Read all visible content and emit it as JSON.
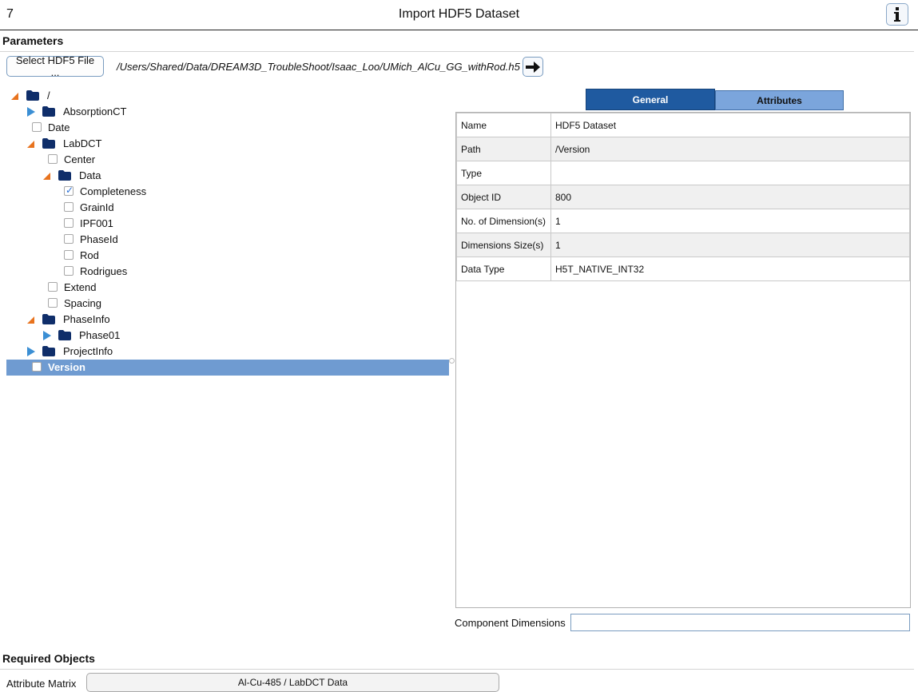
{
  "header": {
    "number": "7",
    "title": "Import HDF5 Dataset"
  },
  "parameters": {
    "section_title": "Parameters",
    "select_file_label": "Select HDF5 File ...",
    "file_path": "/Users/Shared/Data/DREAM3D_TroubleShoot/Isaac_Loo/UMich_AlCu_GG_withRod.h5"
  },
  "tree": [
    {
      "label": "/",
      "type": "group",
      "expanded": true
    },
    {
      "label": "AbsorptionCT",
      "type": "group",
      "expanded": false
    },
    {
      "label": "Date",
      "type": "dataset",
      "checked": false
    },
    {
      "label": "LabDCT",
      "type": "group",
      "expanded": true
    },
    {
      "label": "Center",
      "type": "dataset",
      "checked": false
    },
    {
      "label": "Data",
      "type": "group",
      "expanded": true
    },
    {
      "label": "Completeness",
      "type": "dataset",
      "checked": true
    },
    {
      "label": "GrainId",
      "type": "dataset",
      "checked": false
    },
    {
      "label": "IPF001",
      "type": "dataset",
      "checked": false
    },
    {
      "label": "PhaseId",
      "type": "dataset",
      "checked": false
    },
    {
      "label": "Rod",
      "type": "dataset",
      "checked": false
    },
    {
      "label": "Rodrigues",
      "type": "dataset",
      "checked": false
    },
    {
      "label": "Extend",
      "type": "dataset",
      "checked": false
    },
    {
      "label": "Spacing",
      "type": "dataset",
      "checked": false
    },
    {
      "label": "PhaseInfo",
      "type": "group",
      "expanded": true
    },
    {
      "label": "Phase01",
      "type": "group",
      "expanded": false
    },
    {
      "label": "ProjectInfo",
      "type": "group",
      "expanded": false
    },
    {
      "label": "Version",
      "type": "dataset",
      "checked": false,
      "selected": true
    }
  ],
  "tabs": {
    "general": "General",
    "attributes": "Attributes"
  },
  "properties": [
    {
      "key": "Name",
      "value": "HDF5 Dataset"
    },
    {
      "key": "Path",
      "value": "/Version"
    },
    {
      "key": "Type",
      "value": ""
    },
    {
      "key": "Object ID",
      "value": "800"
    },
    {
      "key": "No. of Dimension(s)",
      "value": "1"
    },
    {
      "key": "Dimensions Size(s)",
      "value": "1"
    },
    {
      "key": "Data Type",
      "value": "H5T_NATIVE_INT32"
    }
  ],
  "component_dimensions": {
    "label": "Component Dimensions",
    "value": ""
  },
  "required_objects": {
    "section_title": "Required Objects",
    "attribute_matrix_label": "Attribute Matrix",
    "attribute_matrix_value": "Al-Cu-485 / LabDCT Data"
  },
  "colors": {
    "accent_dark": "#1f5aa0",
    "accent_light": "#7ba5dc",
    "selection": "#6f9bd1",
    "folder": "#0f2e6a",
    "expand_open": "#e8731e",
    "expand_closed": "#3b8fd4"
  },
  "icons": {
    "info": "info-icon",
    "go": "arrow-right-icon",
    "folder": "folder-icon",
    "expanded": "triangle-expanded-icon",
    "collapsed": "triangle-collapsed-icon",
    "checkbox": "checkbox-icon"
  }
}
